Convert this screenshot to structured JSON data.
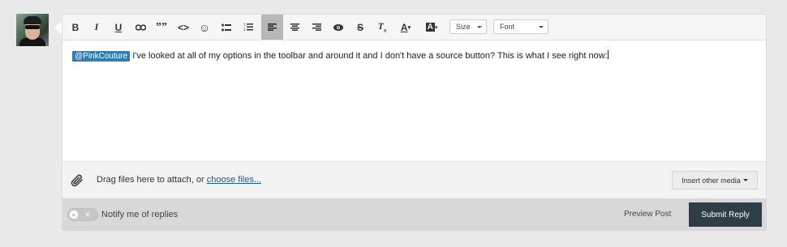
{
  "toolbar": {
    "buttons": [
      {
        "name": "bold",
        "glyph": "B"
      },
      {
        "name": "italic",
        "glyph": "I"
      },
      {
        "name": "underline",
        "glyph": "U"
      },
      {
        "name": "link",
        "glyph": ""
      },
      {
        "name": "quote",
        "glyph": "””"
      },
      {
        "name": "code",
        "glyph": "<>"
      },
      {
        "name": "emoji",
        "glyph": "☺"
      },
      {
        "name": "bulleted-list",
        "glyph": ""
      },
      {
        "name": "numbered-list",
        "glyph": ""
      },
      {
        "name": "align-left",
        "glyph": "",
        "active": true
      },
      {
        "name": "align-center",
        "glyph": ""
      },
      {
        "name": "align-right",
        "glyph": ""
      },
      {
        "name": "preview-eye",
        "glyph": ""
      },
      {
        "name": "strikethrough",
        "glyph": "S"
      },
      {
        "name": "clear-formatting",
        "glyph": "T"
      },
      {
        "name": "text-color",
        "glyph": "A"
      },
      {
        "name": "background-color",
        "glyph": "A"
      }
    ],
    "size_select": "Size",
    "font_select": "Font"
  },
  "message": {
    "mention": "@PinkCouture",
    "text": "I've looked at all of my options in the toolbar and around it and I don't have a source button? This is what I see right now:"
  },
  "attach": {
    "prefix": "Drag files here to attach, or ",
    "link": "choose files...",
    "insert_media": "Insert other media"
  },
  "footer": {
    "notify_label": "Notify me of replies",
    "toggle_state": "off",
    "preview_label": "Preview Post",
    "submit_label": "Submit Reply"
  },
  "colors": {
    "mention_bg": "#2f7fb5",
    "submit_bg": "#2e3d46",
    "active_tool_bg": "#b8b8b8"
  }
}
